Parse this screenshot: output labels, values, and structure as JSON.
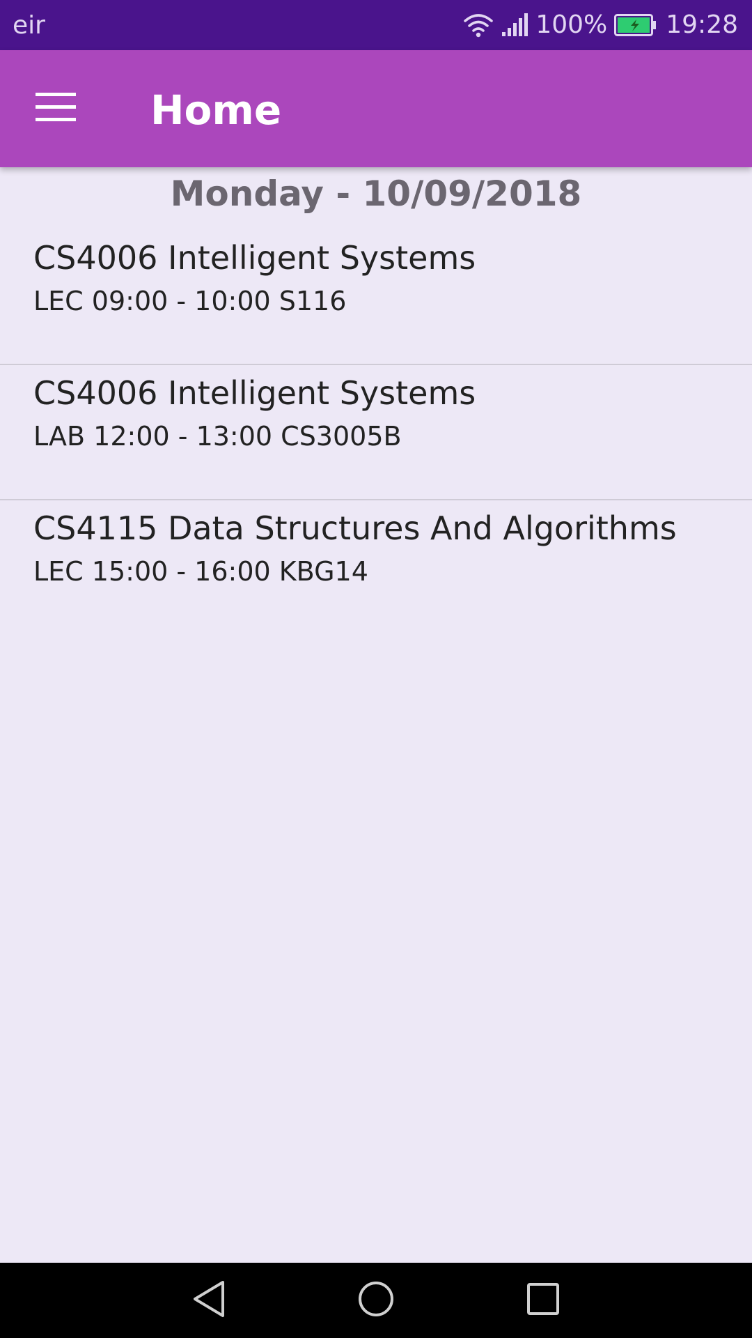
{
  "status_bar": {
    "carrier": "eir",
    "battery_percent": "100%",
    "time": "19:28",
    "icons": [
      "wifi-icon",
      "signal-icon",
      "battery-charging-icon"
    ]
  },
  "app_bar": {
    "title": "Home",
    "menu_icon": "hamburger-menu-icon"
  },
  "schedule": {
    "date_header": "Monday - 10/09/2018",
    "items": [
      {
        "course": "CS4006 Intelligent Systems",
        "details": "LEC 09:00 - 10:00 S116"
      },
      {
        "course": "CS4006 Intelligent Systems",
        "details": "LAB 12:00 - 13:00 CS3005B"
      },
      {
        "course": "CS4115 Data Structures And Algorithms",
        "details": "LEC 15:00 - 16:00 KBG14"
      }
    ]
  },
  "nav_bar": {
    "icons": [
      "back-icon",
      "home-icon",
      "recents-icon"
    ]
  },
  "colors": {
    "status_bar": "#4a148c",
    "app_bar": "#ab47bc",
    "background": "#ede8f6",
    "battery_fill": "#2ecc71"
  }
}
